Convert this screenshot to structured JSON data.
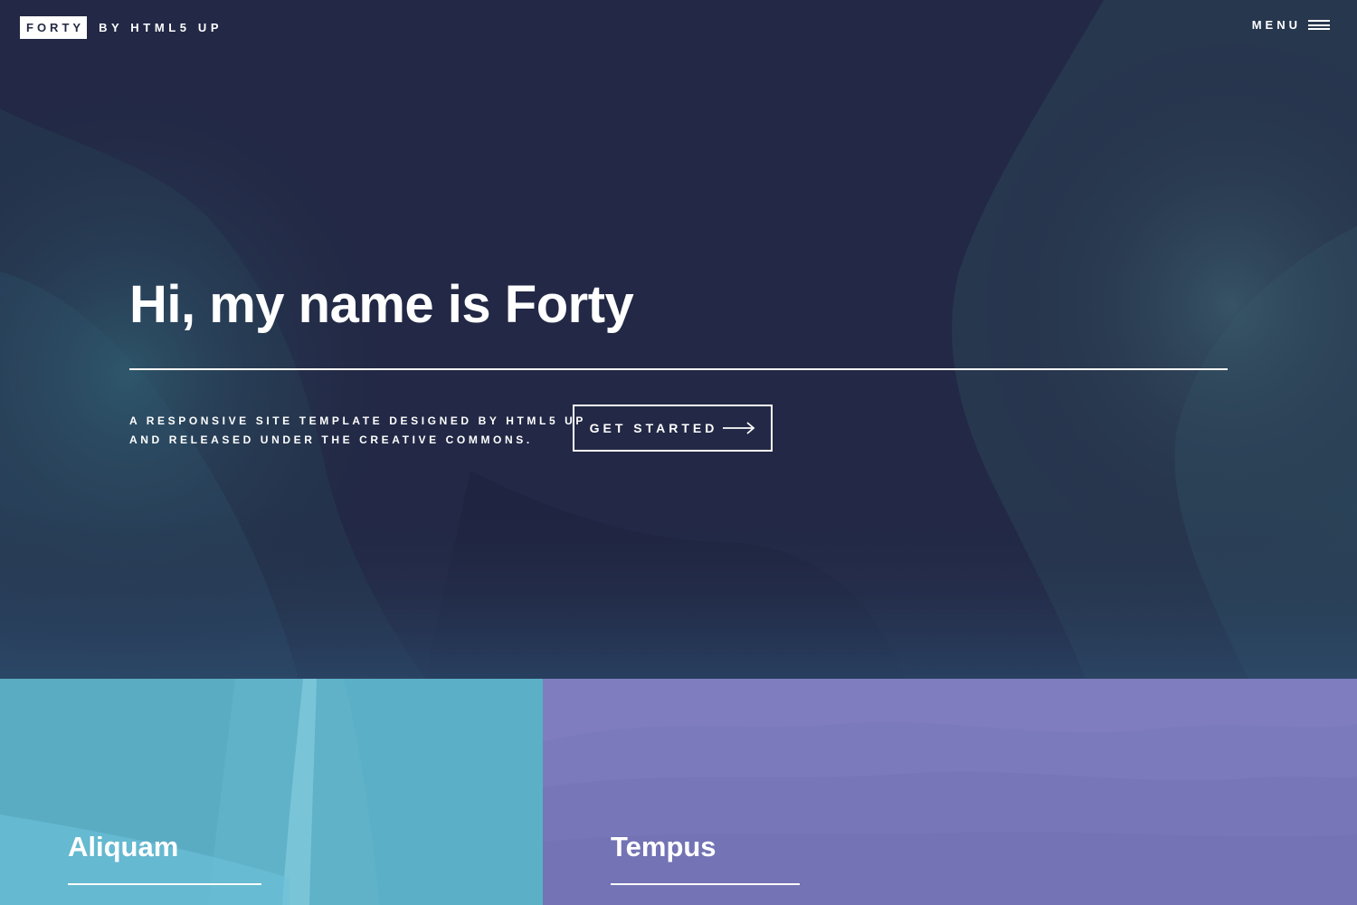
{
  "header": {
    "logo_text": "FORTY",
    "logo_byline": "BY HTML5 UP",
    "menu_label": "MENU"
  },
  "banner": {
    "title": "Hi, my name is Forty",
    "tagline_line1": "A RESPONSIVE SITE TEMPLATE DESIGNED BY HTML5 UP",
    "tagline_line2": "AND RELEASED UNDER THE CREATIVE COMMONS.",
    "cta_label": "GET STARTED"
  },
  "tiles": [
    {
      "title": "Aliquam",
      "color": "#6fc3df"
    },
    {
      "title": "Tempus",
      "color": "#8d82c4"
    }
  ],
  "icons": {
    "menu": "hamburger-icon",
    "cta": "arrow-right-icon"
  },
  "colors": {
    "background": "#242943",
    "text": "#ffffff",
    "tile_blue": "#6fc3df",
    "tile_purple": "#8d82c4"
  }
}
